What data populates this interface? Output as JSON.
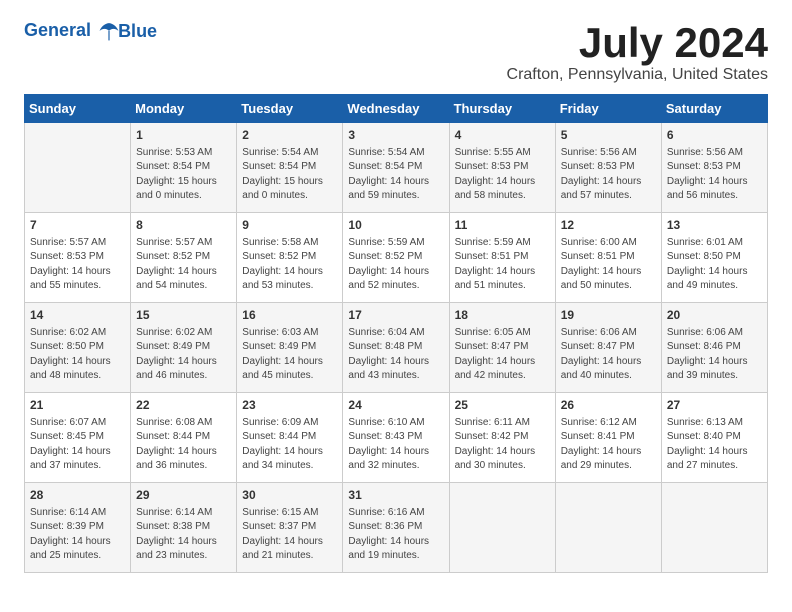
{
  "header": {
    "logo_line1": "General",
    "logo_line2": "Blue",
    "title": "July 2024",
    "subtitle": "Crafton, Pennsylvania, United States"
  },
  "weekdays": [
    "Sunday",
    "Monday",
    "Tuesday",
    "Wednesday",
    "Thursday",
    "Friday",
    "Saturday"
  ],
  "weeks": [
    [
      {
        "day": "",
        "info": ""
      },
      {
        "day": "1",
        "info": "Sunrise: 5:53 AM\nSunset: 8:54 PM\nDaylight: 15 hours\nand 0 minutes."
      },
      {
        "day": "2",
        "info": "Sunrise: 5:54 AM\nSunset: 8:54 PM\nDaylight: 15 hours\nand 0 minutes."
      },
      {
        "day": "3",
        "info": "Sunrise: 5:54 AM\nSunset: 8:54 PM\nDaylight: 14 hours\nand 59 minutes."
      },
      {
        "day": "4",
        "info": "Sunrise: 5:55 AM\nSunset: 8:53 PM\nDaylight: 14 hours\nand 58 minutes."
      },
      {
        "day": "5",
        "info": "Sunrise: 5:56 AM\nSunset: 8:53 PM\nDaylight: 14 hours\nand 57 minutes."
      },
      {
        "day": "6",
        "info": "Sunrise: 5:56 AM\nSunset: 8:53 PM\nDaylight: 14 hours\nand 56 minutes."
      }
    ],
    [
      {
        "day": "7",
        "info": "Sunrise: 5:57 AM\nSunset: 8:53 PM\nDaylight: 14 hours\nand 55 minutes."
      },
      {
        "day": "8",
        "info": "Sunrise: 5:57 AM\nSunset: 8:52 PM\nDaylight: 14 hours\nand 54 minutes."
      },
      {
        "day": "9",
        "info": "Sunrise: 5:58 AM\nSunset: 8:52 PM\nDaylight: 14 hours\nand 53 minutes."
      },
      {
        "day": "10",
        "info": "Sunrise: 5:59 AM\nSunset: 8:52 PM\nDaylight: 14 hours\nand 52 minutes."
      },
      {
        "day": "11",
        "info": "Sunrise: 5:59 AM\nSunset: 8:51 PM\nDaylight: 14 hours\nand 51 minutes."
      },
      {
        "day": "12",
        "info": "Sunrise: 6:00 AM\nSunset: 8:51 PM\nDaylight: 14 hours\nand 50 minutes."
      },
      {
        "day": "13",
        "info": "Sunrise: 6:01 AM\nSunset: 8:50 PM\nDaylight: 14 hours\nand 49 minutes."
      }
    ],
    [
      {
        "day": "14",
        "info": "Sunrise: 6:02 AM\nSunset: 8:50 PM\nDaylight: 14 hours\nand 48 minutes."
      },
      {
        "day": "15",
        "info": "Sunrise: 6:02 AM\nSunset: 8:49 PM\nDaylight: 14 hours\nand 46 minutes."
      },
      {
        "day": "16",
        "info": "Sunrise: 6:03 AM\nSunset: 8:49 PM\nDaylight: 14 hours\nand 45 minutes."
      },
      {
        "day": "17",
        "info": "Sunrise: 6:04 AM\nSunset: 8:48 PM\nDaylight: 14 hours\nand 43 minutes."
      },
      {
        "day": "18",
        "info": "Sunrise: 6:05 AM\nSunset: 8:47 PM\nDaylight: 14 hours\nand 42 minutes."
      },
      {
        "day": "19",
        "info": "Sunrise: 6:06 AM\nSunset: 8:47 PM\nDaylight: 14 hours\nand 40 minutes."
      },
      {
        "day": "20",
        "info": "Sunrise: 6:06 AM\nSunset: 8:46 PM\nDaylight: 14 hours\nand 39 minutes."
      }
    ],
    [
      {
        "day": "21",
        "info": "Sunrise: 6:07 AM\nSunset: 8:45 PM\nDaylight: 14 hours\nand 37 minutes."
      },
      {
        "day": "22",
        "info": "Sunrise: 6:08 AM\nSunset: 8:44 PM\nDaylight: 14 hours\nand 36 minutes."
      },
      {
        "day": "23",
        "info": "Sunrise: 6:09 AM\nSunset: 8:44 PM\nDaylight: 14 hours\nand 34 minutes."
      },
      {
        "day": "24",
        "info": "Sunrise: 6:10 AM\nSunset: 8:43 PM\nDaylight: 14 hours\nand 32 minutes."
      },
      {
        "day": "25",
        "info": "Sunrise: 6:11 AM\nSunset: 8:42 PM\nDaylight: 14 hours\nand 30 minutes."
      },
      {
        "day": "26",
        "info": "Sunrise: 6:12 AM\nSunset: 8:41 PM\nDaylight: 14 hours\nand 29 minutes."
      },
      {
        "day": "27",
        "info": "Sunrise: 6:13 AM\nSunset: 8:40 PM\nDaylight: 14 hours\nand 27 minutes."
      }
    ],
    [
      {
        "day": "28",
        "info": "Sunrise: 6:14 AM\nSunset: 8:39 PM\nDaylight: 14 hours\nand 25 minutes."
      },
      {
        "day": "29",
        "info": "Sunrise: 6:14 AM\nSunset: 8:38 PM\nDaylight: 14 hours\nand 23 minutes."
      },
      {
        "day": "30",
        "info": "Sunrise: 6:15 AM\nSunset: 8:37 PM\nDaylight: 14 hours\nand 21 minutes."
      },
      {
        "day": "31",
        "info": "Sunrise: 6:16 AM\nSunset: 8:36 PM\nDaylight: 14 hours\nand 19 minutes."
      },
      {
        "day": "",
        "info": ""
      },
      {
        "day": "",
        "info": ""
      },
      {
        "day": "",
        "info": ""
      }
    ]
  ]
}
